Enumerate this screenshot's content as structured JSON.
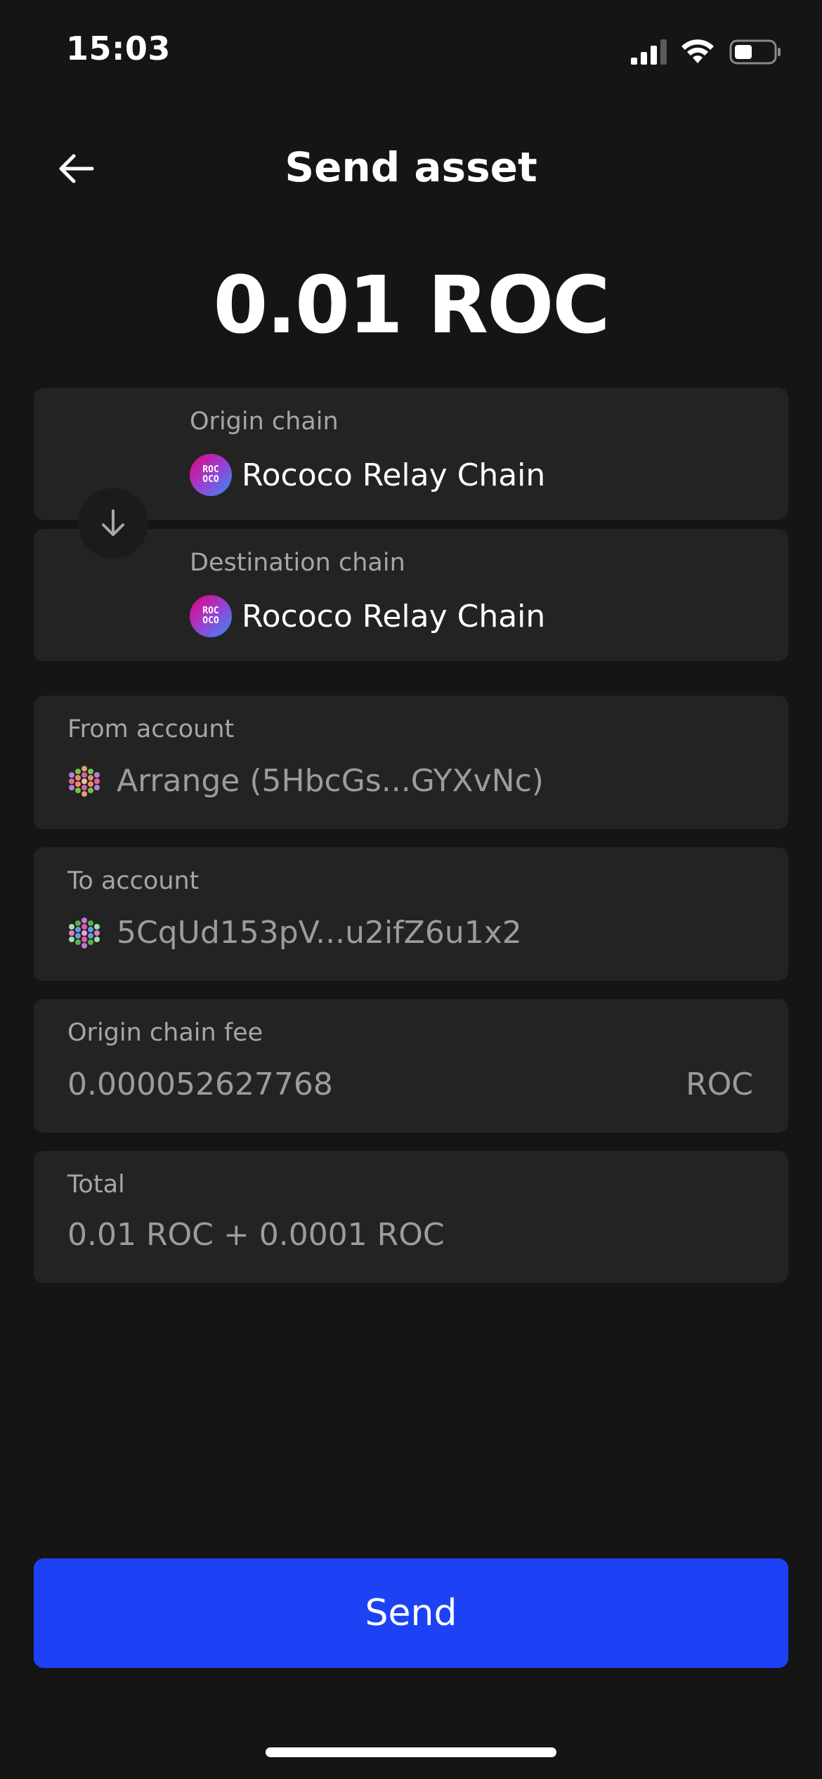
{
  "status_bar": {
    "time": "15:03"
  },
  "header": {
    "title": "Send asset"
  },
  "amount": "0.01 ROC",
  "origin": {
    "label": "Origin chain",
    "chain": "Rococo Relay Chain",
    "logo_text_top": "ROC",
    "logo_text_bottom": "OCO"
  },
  "destination": {
    "label": "Destination chain",
    "chain": "Rococo Relay Chain",
    "logo_text_top": "ROC",
    "logo_text_bottom": "OCO"
  },
  "from_account": {
    "label": "From account",
    "value": "Arrange (5HbcGs...GYXvNc)"
  },
  "to_account": {
    "label": "To account",
    "value": "5CqUd153pV...u2ifZ6u1x2"
  },
  "fee": {
    "label": "Origin chain fee",
    "value": "0.000052627768",
    "unit": "ROC"
  },
  "total": {
    "label": "Total",
    "value": "0.01 ROC + 0.0001 ROC"
  },
  "send_button": "Send",
  "colors": {
    "background": "#151516",
    "card": "#232324",
    "accent": "#1d42f5"
  }
}
